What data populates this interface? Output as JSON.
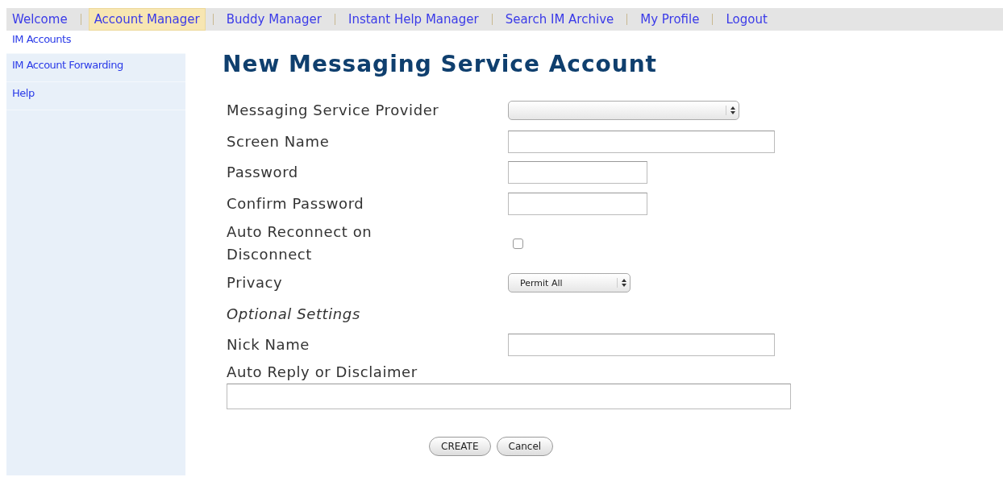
{
  "nav": [
    {
      "label": "Welcome",
      "selected": false
    },
    {
      "label": "Account Manager",
      "selected": true
    },
    {
      "label": "Buddy Manager",
      "selected": false
    },
    {
      "label": "Instant Help Manager",
      "selected": false
    },
    {
      "label": "Search IM Archive",
      "selected": false
    },
    {
      "label": "My Profile",
      "selected": false
    },
    {
      "label": "Logout",
      "selected": false
    }
  ],
  "sidebar": {
    "items": [
      {
        "label": "IM Accounts",
        "selected": true
      },
      {
        "label": "IM Account Forwarding",
        "selected": false
      },
      {
        "label": "Help",
        "selected": false
      }
    ]
  },
  "form": {
    "title": "New Messaging Service Account",
    "fields": [
      {
        "kind": "select",
        "label": "Messaging Service Provider"
      },
      {
        "kind": "text",
        "label": "Screen Name"
      },
      {
        "kind": "password",
        "label": "Password"
      },
      {
        "kind": "password",
        "label": "Confirm Password"
      },
      {
        "kind": "checkbox",
        "label": "Auto Reconnect on Disconnect",
        "checked": false
      },
      {
        "kind": "select",
        "label": "Privacy",
        "value": "Permit All"
      },
      {
        "kind": "section",
        "label": "Optional Settings"
      },
      {
        "kind": "text",
        "label": "Nick Name"
      },
      {
        "kind": "wide",
        "label": "Auto Reply or Disclaimer"
      }
    ],
    "buttons": [
      "CREATE",
      "Cancel"
    ]
  }
}
